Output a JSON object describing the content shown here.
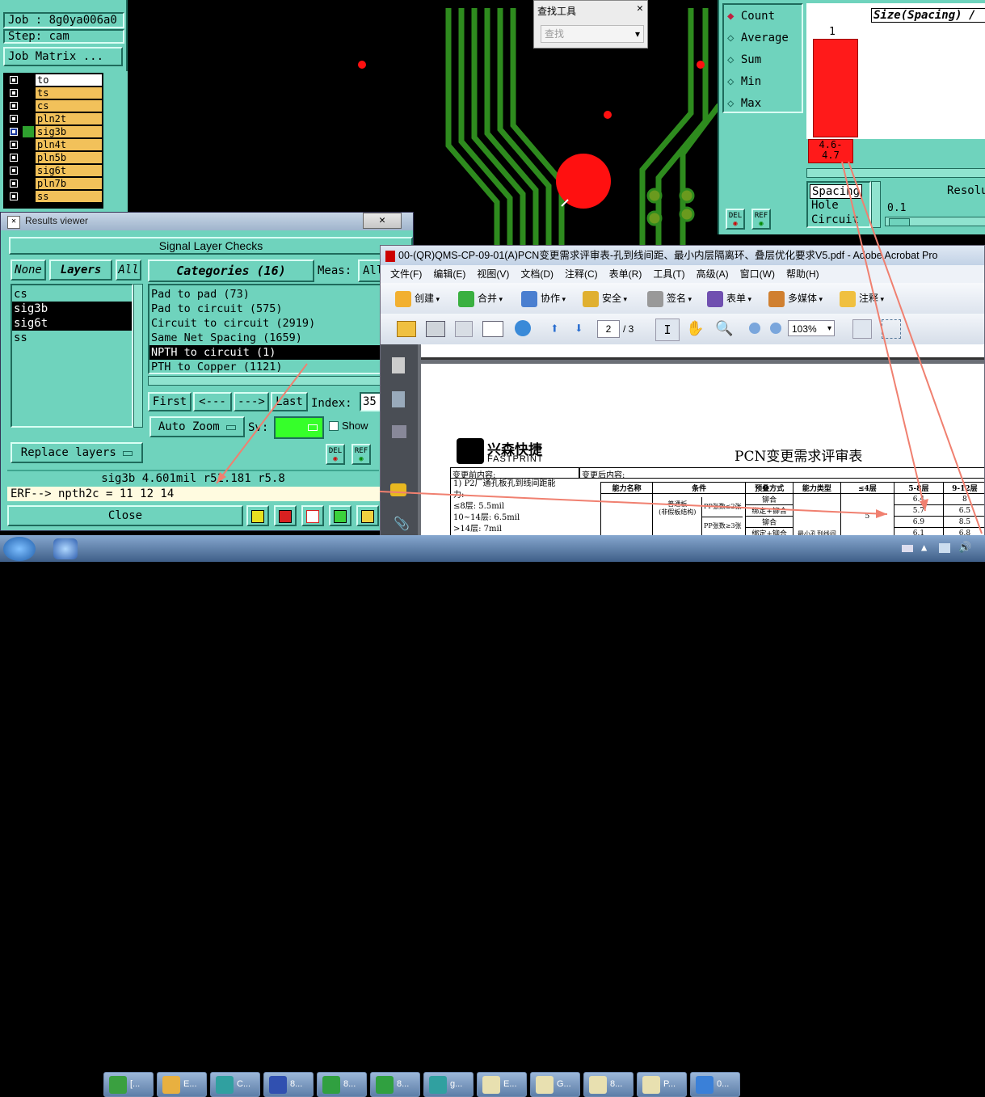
{
  "job": {
    "label": "Job : 8g0ya006a0",
    "step": "Step: cam",
    "matrix_btn": "Job Matrix ..."
  },
  "layers": [
    "to",
    "ts",
    "cs",
    "pln2t",
    "sig3b",
    "pln4t",
    "pln5b",
    "sig6t",
    "pln7b",
    "ss"
  ],
  "search_tool": {
    "title": "查找工具",
    "placeholder": "查找"
  },
  "stats": {
    "options": [
      "Count",
      "Average",
      "Sum",
      "Min",
      "Max"
    ],
    "selected": "Count"
  },
  "histogram": {
    "title": "Size(Spacing) /",
    "bar_count": "1",
    "bar_range": "4.6-\n4.7",
    "param_list": [
      "Spacing",
      "Hole",
      "Circuit"
    ],
    "resolution_label": "Resolu",
    "resolution_value": "0.1"
  },
  "chart_data": {
    "type": "bar",
    "categories": [
      "4.6-4.7"
    ],
    "values": [
      1
    ],
    "title": "Size(Spacing) /"
  },
  "results": {
    "title": "Results viewer",
    "section_title": "Signal Layer Checks",
    "none_btn": "None",
    "layers_btn": "Layers",
    "all_btn": "All",
    "layer_list": [
      "cs",
      "sig3b",
      "sig6t",
      "ss"
    ],
    "categories_btn": "Categories (16)",
    "meas_label": "Meas:",
    "meas_value": "All",
    "categories": [
      "Pad to pad (73)",
      "Pad to circuit (575)",
      "Circuit to circuit (2919)",
      "Same Net Spacing (1659)",
      "NPTH to circuit (1)",
      "PTH to Copper (1121)"
    ],
    "selected_category": 4,
    "first_btn": "First",
    "prev_btn": "<---",
    "next_btn": "--->",
    "last_btn": "Last",
    "index_label": "Index:",
    "index_value": "35",
    "autozoom_btn": "Auto Zoom",
    "sv_label": "Sv:",
    "show_label": "Show",
    "replace_btn": "Replace layers",
    "del": "DEL",
    "ref": "REF",
    "measure_line": "sig3b 4.601mil  r51.181  r5.8",
    "erf_line": "ERF--> npth2c = 11 12 14",
    "close_btn": "Close"
  },
  "acrobat": {
    "title": "00-(QR)QMS-CP-09-01(A)PCN变更需求评审表-孔到线间距、最小内层隔离环、叠层优化要求V5.pdf - Adobe Acrobat Pro",
    "menu": [
      "文件(F)",
      "编辑(E)",
      "视图(V)",
      "文档(D)",
      "注释(C)",
      "表单(R)",
      "工具(T)",
      "高级(A)",
      "窗口(W)",
      "帮助(H)"
    ],
    "toolbar": [
      "创建",
      "合并",
      "协作",
      "安全",
      "签名",
      "表单",
      "多媒体",
      "注释"
    ],
    "page_current": "2",
    "page_total": "/ 3",
    "zoom": "103%",
    "company_cn": "兴森快捷",
    "company_en": "FASTPRINT",
    "doc_title": "PCN变更需求评审表",
    "before_label": "变更前内容:",
    "after_label": "变更后内容:",
    "before_lines": [
      "1) P2厂通孔板孔到线间距能",
      "力:",
      "≤8层: 5.5mil",
      "10~14层: 6.5mil",
      ">14层: 7mil"
    ],
    "table_headers": [
      "能力名称",
      "条件",
      "预叠方式",
      "能力类型",
      "≤4层",
      "5-8层",
      "9-12层"
    ],
    "table_cond_a": "普通板\n(非假板结构)",
    "table_pp_a": "PP张数≤2张",
    "table_pp_b": "PP张数≥3张",
    "table_stack": [
      "铆合",
      "绑定+铆合",
      "铆合",
      "绑定+铆合"
    ],
    "table_type": "最小孔到线间",
    "table_le4": "5",
    "table_58": [
      "6.4",
      "5.7",
      "6.9",
      "6.1"
    ],
    "table_912": [
      "8",
      "6.5",
      "8.5",
      "6.8"
    ]
  },
  "taskbar": {
    "items": [
      "[...",
      "E...",
      "C...",
      "8...",
      "8...",
      "8...",
      "g...",
      "E...",
      "G...",
      "8...",
      "P...",
      "0..."
    ]
  }
}
